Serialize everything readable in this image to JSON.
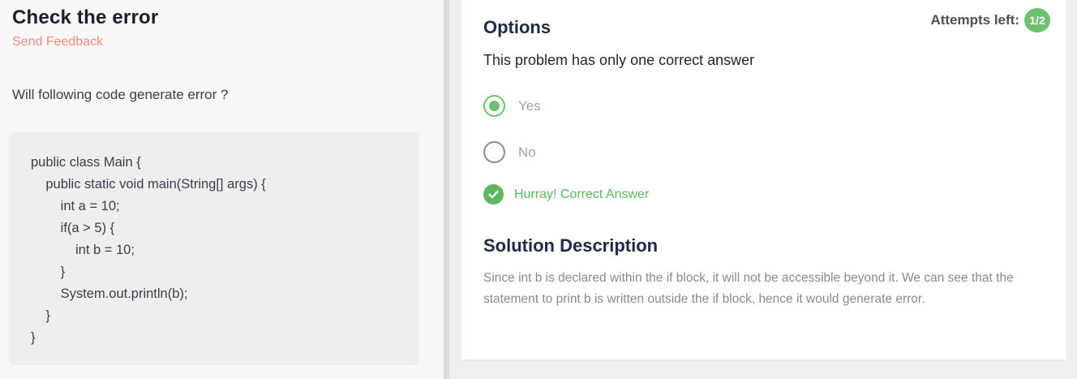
{
  "problem": {
    "title": "Check the error",
    "feedback_label": "Send Feedback",
    "question": "Will following code generate error ?",
    "code_lines": [
      "public class Main {",
      "    public static void main(String[] args) {",
      "        int a = 10;",
      "        if(a > 5) {",
      "            int b = 10;",
      "        }",
      "        System.out.println(b);",
      "    }",
      "}"
    ]
  },
  "options_panel": {
    "title": "Options",
    "attempts_label": "Attempts left:",
    "attempts_value": "1/2",
    "instruction": "This problem has only one correct answer",
    "options": [
      {
        "label": "Yes",
        "selected": true
      },
      {
        "label": "No",
        "selected": false
      }
    ],
    "result_text": "Hurray! Correct Answer",
    "solution_title": "Solution Description",
    "solution_text": "Since int b is declared within the if block, it will not be accessible beyond it. We can see that the statement to print b is written outside the if block, hence it would generate error."
  },
  "colors": {
    "accent_green": "#6cc070",
    "feedback_red": "#f08b7a"
  }
}
